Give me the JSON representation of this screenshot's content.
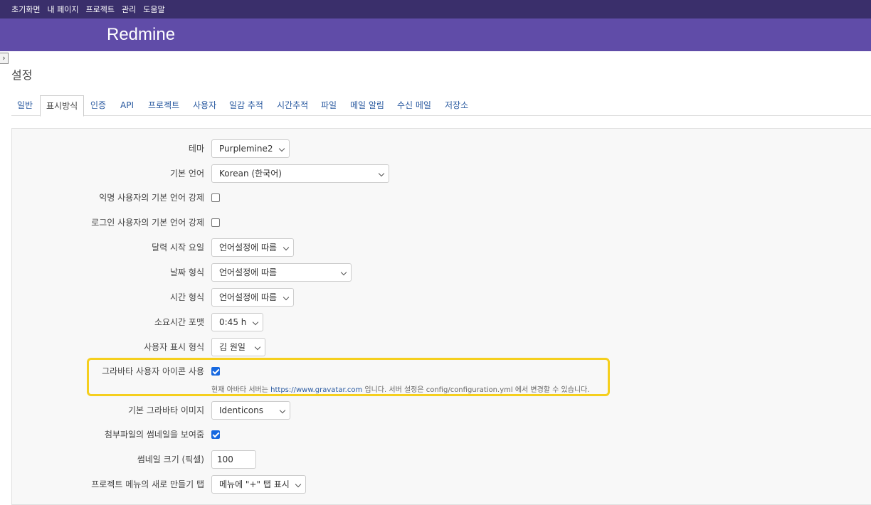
{
  "top_menu": {
    "home": "초기화면",
    "my_page": "내 페이지",
    "projects": "프로젝트",
    "admin": "관리",
    "help": "도움말"
  },
  "header": {
    "title": "Redmine"
  },
  "page": {
    "title": "설정"
  },
  "tabs": [
    {
      "label": "일반"
    },
    {
      "label": "표시방식"
    },
    {
      "label": "인증"
    },
    {
      "label": "API"
    },
    {
      "label": "프로젝트"
    },
    {
      "label": "사용자"
    },
    {
      "label": "일감 추적"
    },
    {
      "label": "시간추적"
    },
    {
      "label": "파일"
    },
    {
      "label": "메일 알림"
    },
    {
      "label": "수신 메일"
    },
    {
      "label": "저장소"
    }
  ],
  "active_tab": "표시방식",
  "settings": {
    "theme": {
      "label": "테마",
      "value": "Purplemine2"
    },
    "default_language": {
      "label": "기본 언어",
      "value": "Korean (한국어)"
    },
    "force_default_language_anonymous": {
      "label": "익명 사용자의 기본 언어 강제",
      "checked": false
    },
    "force_default_language_logged_in": {
      "label": "로그인 사용자의 기본 언어 강제",
      "checked": false
    },
    "start_of_week": {
      "label": "달력 시작 요일",
      "value": "언어설정에 따름"
    },
    "date_format": {
      "label": "날짜 형식",
      "value": "언어설정에 따름"
    },
    "time_format": {
      "label": "시간 형식",
      "value": "언어설정에 따름"
    },
    "timespan_format": {
      "label": "소요시간 포맷",
      "value": "0:45 h"
    },
    "user_format": {
      "label": "사용자 표시 형식",
      "value": "김 원일"
    },
    "gravatar_enabled": {
      "label": "그라바타 사용자 아이콘 사용",
      "checked": true,
      "hint_prefix": "현재 아바타 서버는",
      "hint_link": "https://www.gravatar.com",
      "hint_suffix": "입니다. 서버 설정은 config/configuration.yml 에서 변경할 수 있습니다."
    },
    "gravatar_default": {
      "label": "기본 그라바타 이미지",
      "value": "Identicons"
    },
    "thumbnails_enabled": {
      "label": "첨부파일의 썸네일을 보여줌",
      "checked": true
    },
    "thumbnails_size": {
      "label": "썸네일 크기 (픽셀)",
      "value": "100"
    },
    "new_item_menu_tab": {
      "label": "프로젝트 메뉴의 새로 만들기 탭",
      "value": "메뉴에 \"+\" 탭 표시"
    }
  },
  "colors": {
    "topbar": "#3a2f6b",
    "header": "#604ca8",
    "link": "#2a5aa0",
    "highlight": "#f5cf1e",
    "checkbox": "#1769e0"
  }
}
